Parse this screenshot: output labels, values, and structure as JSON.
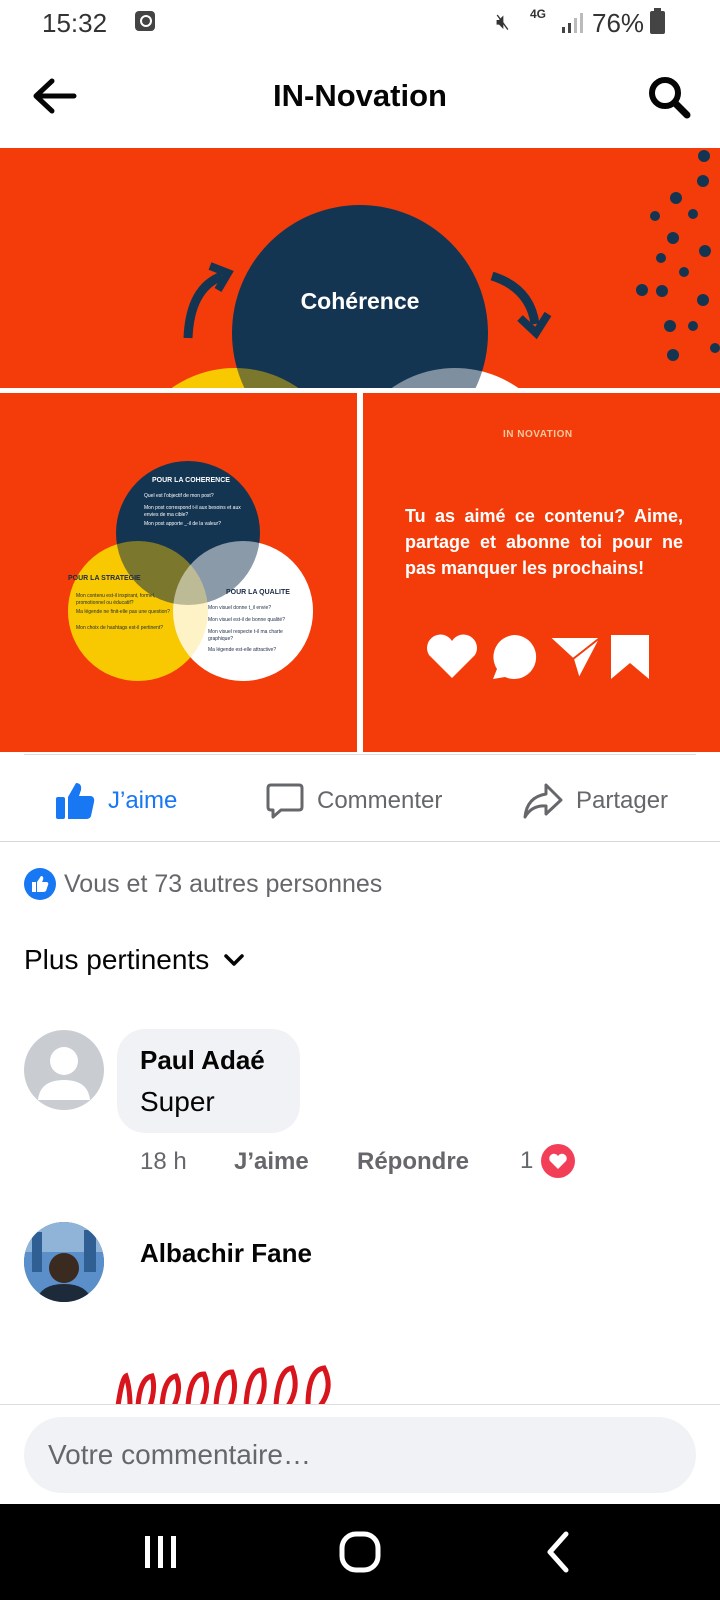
{
  "status_bar": {
    "time": "15:32",
    "network": "4G",
    "battery": "76%"
  },
  "header": {
    "title": "IN-Novation"
  },
  "post_images": {
    "top_label": "Cohérence",
    "bottom_left": {
      "circle_top_title": "POUR LA COHERENCE",
      "circle_top_lines": [
        "Quel est l'objectif de mon post?",
        "Mon post correspond t-il aux besoins et aux envies de ma cible?",
        "Mon post apporte _-il de la valeur?"
      ],
      "circle_left_title": "POUR LA STRATEGIE",
      "circle_left_lines": [
        "Mon contenu est-il inspirant, formel, promotionnel ou éducatif?",
        "Ma légende ne finit-elle pas une question?",
        "Mon choix de hashtags est-il pertinent?"
      ],
      "circle_right_title": "POUR LA QUALITE",
      "circle_right_lines": [
        "Mon visuel donne t_il envie?",
        "Mon visuel est-il de bonne qualité?",
        "Mon visuel respecte t-il ma charte graphique?",
        "Ma légende est-elle attractive?"
      ]
    },
    "bottom_right": {
      "logo_text": "IN NOVATION",
      "message": "Tu as aimé ce contenu? Aime, partage et abonne toi pour ne pas manquer les prochains!"
    }
  },
  "actions": {
    "like_label": "J’aime",
    "comment_label": "Commenter",
    "share_label": "Partager"
  },
  "reactions_summary": "Vous et 73 autres personnes",
  "sort_label": "Plus pertinents",
  "comments": [
    {
      "author": "Paul Adaé",
      "text": "Super",
      "time": "18 h",
      "like_label": "J’aime",
      "reply_label": "Répondre",
      "reaction_count": "1"
    },
    {
      "author": "Albachir Fane"
    }
  ],
  "composer": {
    "placeholder": "Votre commentaire…"
  },
  "colors": {
    "brand_blue": "#1877f2",
    "post_orange": "#f43c0a",
    "navy": "#143552",
    "yellow": "#f8c800",
    "heart_red": "#f33e58"
  }
}
